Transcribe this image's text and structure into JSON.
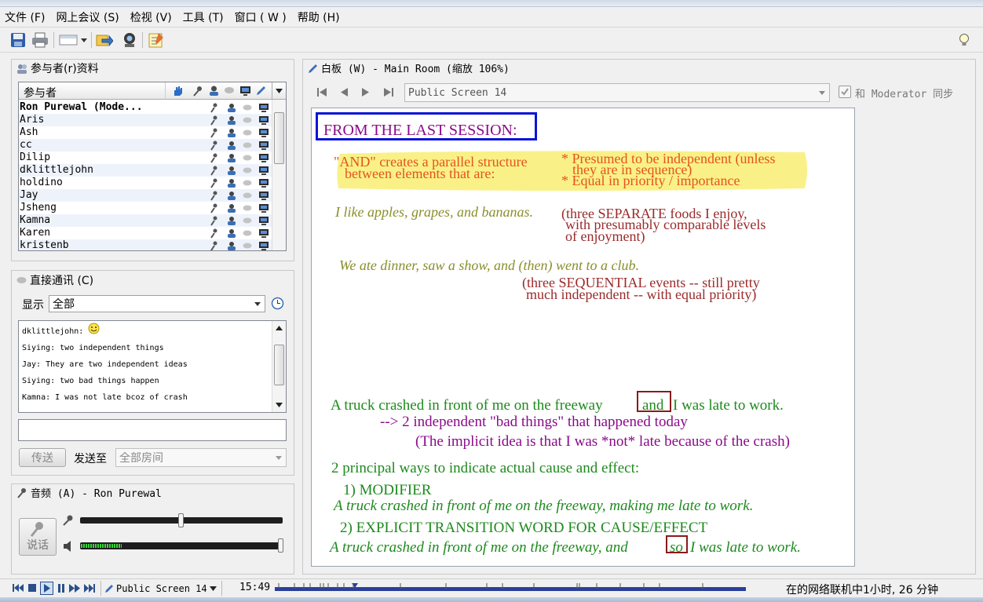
{
  "menu": [
    "文件 (F)",
    "网上会议 (S)",
    "检视 (V)",
    "工具 (T)",
    "窗口 ( W )",
    "帮助 (H)"
  ],
  "icons": {
    "save": "save-icon",
    "print": "print-icon",
    "layout": "layout-dropdown-icon",
    "share": "share-icon",
    "webcam": "webcam-icon",
    "notes": "notes-icon",
    "hint": "lightbulb-icon"
  },
  "participants": {
    "title": "参与者(r)资料",
    "column_header": "参与者",
    "rows": [
      {
        "name": "Ron Purewal (Mode...",
        "bold": true
      },
      {
        "name": "Aris"
      },
      {
        "name": "Ash"
      },
      {
        "name": "cc"
      },
      {
        "name": "Dilip"
      },
      {
        "name": "dklittlejohn"
      },
      {
        "name": "holdino"
      },
      {
        "name": "Jay"
      },
      {
        "name": "Jsheng"
      },
      {
        "name": "Kamna"
      },
      {
        "name": "Karen"
      },
      {
        "name": "kristenb"
      }
    ]
  },
  "chat": {
    "title": "直接通讯 (C)",
    "show_label": "显示",
    "filter_value": "全部",
    "messages": [
      "dklittlejohn:",
      "Siying: two independent things",
      "Jay: They are two independent ideas",
      "Siying: two bad things happen",
      "Kamna: I was not late bcoz of crash"
    ],
    "input_value": "",
    "send_label": "传送",
    "send_to_label": "发送至",
    "send_to_value": "全部房间"
  },
  "audio": {
    "title": "音频 (A) - Ron Purewal",
    "talk_label": "说话",
    "mic_level": 0.5,
    "speaker_level": 1.0,
    "activity_level": 0.2
  },
  "whiteboard": {
    "title": "白板 (W) - Main Room (缩放 106%)",
    "screen_value": "Public Screen 14",
    "sync_label": "和 Moderator 同步",
    "sync_checked": true,
    "content": {
      "heading": "FROM THE LAST SESSION:",
      "and_line1": "\"AND\" creates a parallel structure",
      "and_line2": "between elements that are:",
      "bullet1a": "* Presumed to be independent (unless",
      "bullet1b": "they are in sequence)",
      "bullet2": "* Equal in priority / importance",
      "ex1": "I like apples, grapes, and bananas.",
      "note1a": "(three SEPARATE foods I enjoy,",
      "note1b": "with presumably comparable levels",
      "note1c": "of enjoyment)",
      "ex2": "We ate dinner, saw a show, and (then) went to a club.",
      "note2a": "(three SEQUENTIAL events -- still pretty",
      "note2b": "much independent -- with equal priority)",
      "truck_pre": "A truck crashed in front of me on the freeway",
      "truck_and": "and",
      "truck_post": "I was late to work.",
      "arrow_line": "--> 2 independent \"bad things\" that happened today",
      "implicit": "(The implicit idea is that I was *not* late because of the crash)",
      "principal": "2 principal ways to indicate actual cause and effect:",
      "modifier": "1) MODIFIER",
      "modifier_ex": "A truck crashed in front of me on the freeway, making me late to work.",
      "explicit": "2) EXPLICIT TRANSITION WORD FOR CAUSE/EFFECT",
      "explicit_pre": "A truck crashed in front of me on the freeway, and",
      "explicit_so": "so",
      "explicit_post": "I was late to work."
    }
  },
  "bottom": {
    "screen_value": "Public Screen 14",
    "time": "15:49",
    "status": "在的网络联机中1小时, 26 分钟"
  }
}
